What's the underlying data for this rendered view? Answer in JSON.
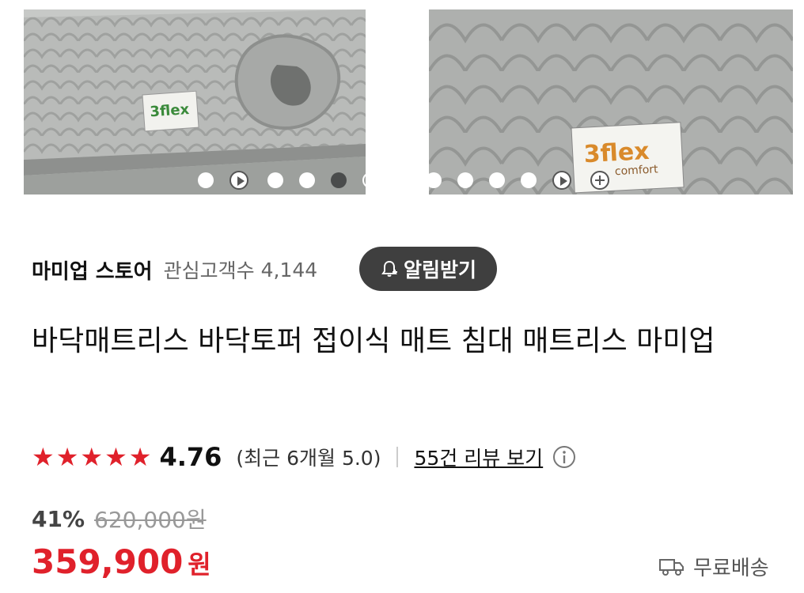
{
  "gallery": {
    "left_tag": "3flex",
    "right_tag": "3flex",
    "right_tag_sub": "comfort",
    "slide_count": 13,
    "active_slide": 5
  },
  "store": {
    "name": "마미업 스토어",
    "followers_label": "관심고객수",
    "followers_count": "4,144",
    "alarm_button": "알림받기"
  },
  "product": {
    "title": "바닥매트리스 바닥토퍼 접이식 매트 침대 매트리스 마미업"
  },
  "rating": {
    "stars": 5,
    "score": "4.76",
    "recent": "(최근 6개월 5.0)",
    "reviews_link": "55건 리뷰 보기"
  },
  "price": {
    "discount": "41%",
    "original": "620,000원",
    "sale": "359,900",
    "currency": "원"
  },
  "shipping": {
    "label": "무료배송"
  },
  "colors": {
    "accent_red": "#e0212b",
    "button_dark": "#3f3f3f"
  }
}
